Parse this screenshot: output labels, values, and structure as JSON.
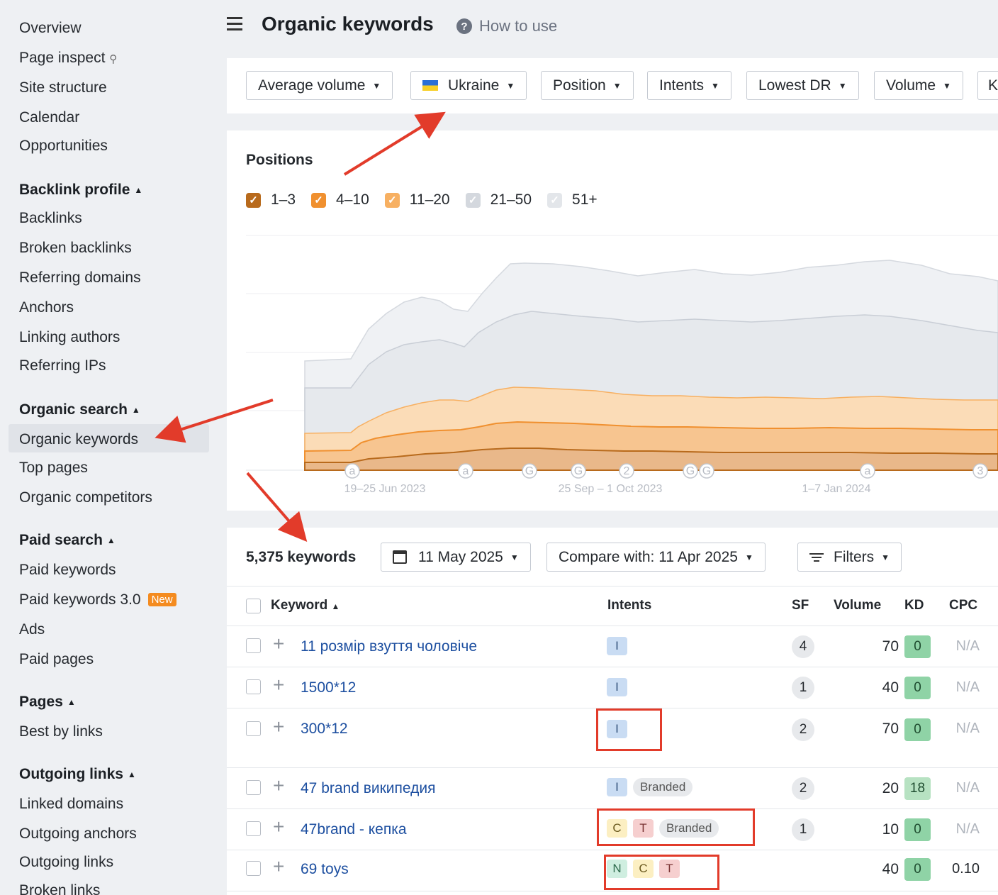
{
  "sidebar": {
    "items_top": [
      "Overview",
      "Page inspect",
      "Site structure",
      "Calendar",
      "Opportunities"
    ],
    "backlink_profile": {
      "heading": "Backlink profile",
      "items": [
        "Backlinks",
        "Broken backlinks",
        "Referring domains",
        "Anchors",
        "Linking authors",
        "Referring IPs"
      ]
    },
    "organic_search": {
      "heading": "Organic search",
      "items": [
        "Organic keywords",
        "Top pages",
        "Organic competitors"
      ]
    },
    "paid_search": {
      "heading": "Paid search",
      "items": [
        "Paid keywords",
        "Paid keywords 3.0",
        "Ads",
        "Paid pages"
      ],
      "new_badge": "New"
    },
    "pages": {
      "heading": "Pages",
      "items": [
        "Best by links"
      ]
    },
    "outgoing_links": {
      "heading": "Outgoing links",
      "items": [
        "Linked domains",
        "Outgoing anchors",
        "Outgoing links",
        "Broken links"
      ]
    }
  },
  "header": {
    "title": "Organic keywords",
    "how_to_use": "How to use"
  },
  "filters": [
    "Average volume",
    "Ukraine",
    "Position",
    "Intents",
    "Lowest DR",
    "Volume",
    "K"
  ],
  "chart_data": {
    "type": "area",
    "title": "Positions",
    "legend": [
      {
        "label": "1–3",
        "color": "#b86a1c",
        "checked": true
      },
      {
        "label": "4–10",
        "color": "#f0902f",
        "checked": true
      },
      {
        "label": "11–20",
        "color": "#f7b062",
        "checked": true
      },
      {
        "label": "21–50",
        "color": "#c9ced6",
        "checked": true
      },
      {
        "label": "51+",
        "color": "#dfe2e7",
        "checked": true
      }
    ],
    "x_ticks": [
      "19–25 Jun 2023",
      "25 Sep – 1 Oct 2023",
      "1–7 Jan 2024"
    ],
    "annotations": [
      "a",
      "a",
      "G",
      "G",
      "2",
      "G",
      "G",
      "a",
      "3"
    ],
    "grid": true
  },
  "table": {
    "count": "5,375 keywords",
    "date": "11 May 2025",
    "compare": "Compare with: 11 Apr 2025",
    "filters": "Filters",
    "columns": [
      "Keyword",
      "Intents",
      "SF",
      "Volume",
      "KD",
      "CPC"
    ],
    "rows": [
      {
        "keyword": "11 розмір взуття чоловіче",
        "intents": [
          "I"
        ],
        "branded": "",
        "sf": "4",
        "volume": "70",
        "kd": "0",
        "cpc": "N/A"
      },
      {
        "keyword": "1500*12",
        "intents": [
          "I"
        ],
        "branded": "",
        "sf": "1",
        "volume": "40",
        "kd": "0",
        "cpc": "N/A"
      },
      {
        "keyword": "300*12",
        "intents": [
          "I"
        ],
        "branded": "",
        "sf": "2",
        "volume": "70",
        "kd": "0",
        "cpc": "N/A"
      },
      {
        "keyword": "47 brand википедия",
        "intents": [
          "I"
        ],
        "branded": "Branded",
        "sf": "2",
        "volume": "20",
        "kd": "18",
        "cpc": "N/A"
      },
      {
        "keyword": "47brand - кепка",
        "intents": [
          "C",
          "T"
        ],
        "branded": "Branded",
        "sf": "1",
        "volume": "10",
        "kd": "0",
        "cpc": "N/A"
      },
      {
        "keyword": "69 toys",
        "intents": [
          "N",
          "C",
          "T"
        ],
        "branded": "",
        "sf": "",
        "volume": "40",
        "kd": "0",
        "cpc": "0.10"
      }
    ]
  },
  "colors": {
    "accent_red": "#e23b2a",
    "link": "#1d4fa0",
    "kd_green": "#8fd3a6"
  }
}
